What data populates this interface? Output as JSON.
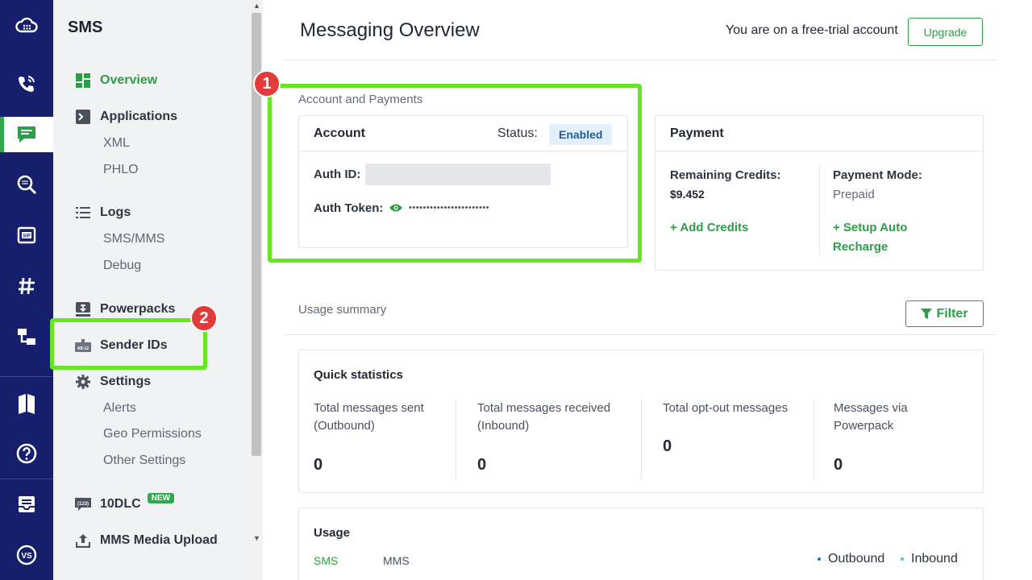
{
  "sidebar": {
    "title": "SMS",
    "items": {
      "overview": "Overview",
      "applications": "Applications",
      "xml": "XML",
      "phlo": "PHLO",
      "logs": "Logs",
      "sms_mms": "SMS/MMS",
      "debug": "Debug",
      "powerpacks": "Powerpacks",
      "sender_ids": "Sender IDs",
      "settings": "Settings",
      "alerts": "Alerts",
      "geo_permissions": "Geo Permissions",
      "other_settings": "Other Settings",
      "tendlc": "10DLC",
      "tendlc_badge": "NEW",
      "mms_upload": "MMS Media Upload"
    }
  },
  "steps": {
    "one": "1",
    "two": "2"
  },
  "header": {
    "title": "Messaging Overview",
    "trial_text": "You are on a free-trial account",
    "upgrade_label": "Upgrade"
  },
  "account_section": {
    "label": "Account and Payments",
    "account_card": {
      "title": "Account",
      "status_label": "Status:",
      "status_value": "Enabled",
      "auth_id_label": "Auth ID:",
      "auth_token_label": "Auth Token:",
      "auth_token_mask": "•••••••••••••••••••••••"
    },
    "payment_card": {
      "title": "Payment",
      "credits_label": "Remaining Credits:",
      "credits_value": "$9.452",
      "add_credits": "+ Add Credits",
      "mode_label": "Payment Mode:",
      "mode_value": "Prepaid",
      "auto_recharge_1": "+ Setup Auto",
      "auto_recharge_2": "Recharge"
    }
  },
  "usage_summary": {
    "label": "Usage summary",
    "filter_label": "Filter",
    "quick_stats": {
      "title": "Quick statistics",
      "items": [
        {
          "line1": "Total messages sent",
          "line2": "(Outbound)",
          "value": "0"
        },
        {
          "line1": "Total messages received",
          "line2": "(Inbound)",
          "value": "0"
        },
        {
          "line1": "Total opt-out messages",
          "line2": "",
          "value": "0"
        },
        {
          "line1": "Messages via",
          "line2": "Powerpack",
          "value": "0"
        }
      ]
    },
    "usage": {
      "title": "Usage",
      "tabs": [
        "SMS",
        "MMS"
      ],
      "legend": [
        "Outbound",
        "Inbound"
      ]
    }
  },
  "colors": {
    "rail": "#151f6d",
    "accent_green": "#2c9e48",
    "highlight": "#66e521",
    "step_badge": "#e33b3b",
    "outbound": "#1f6fd6",
    "inbound": "#4fc3f7"
  }
}
